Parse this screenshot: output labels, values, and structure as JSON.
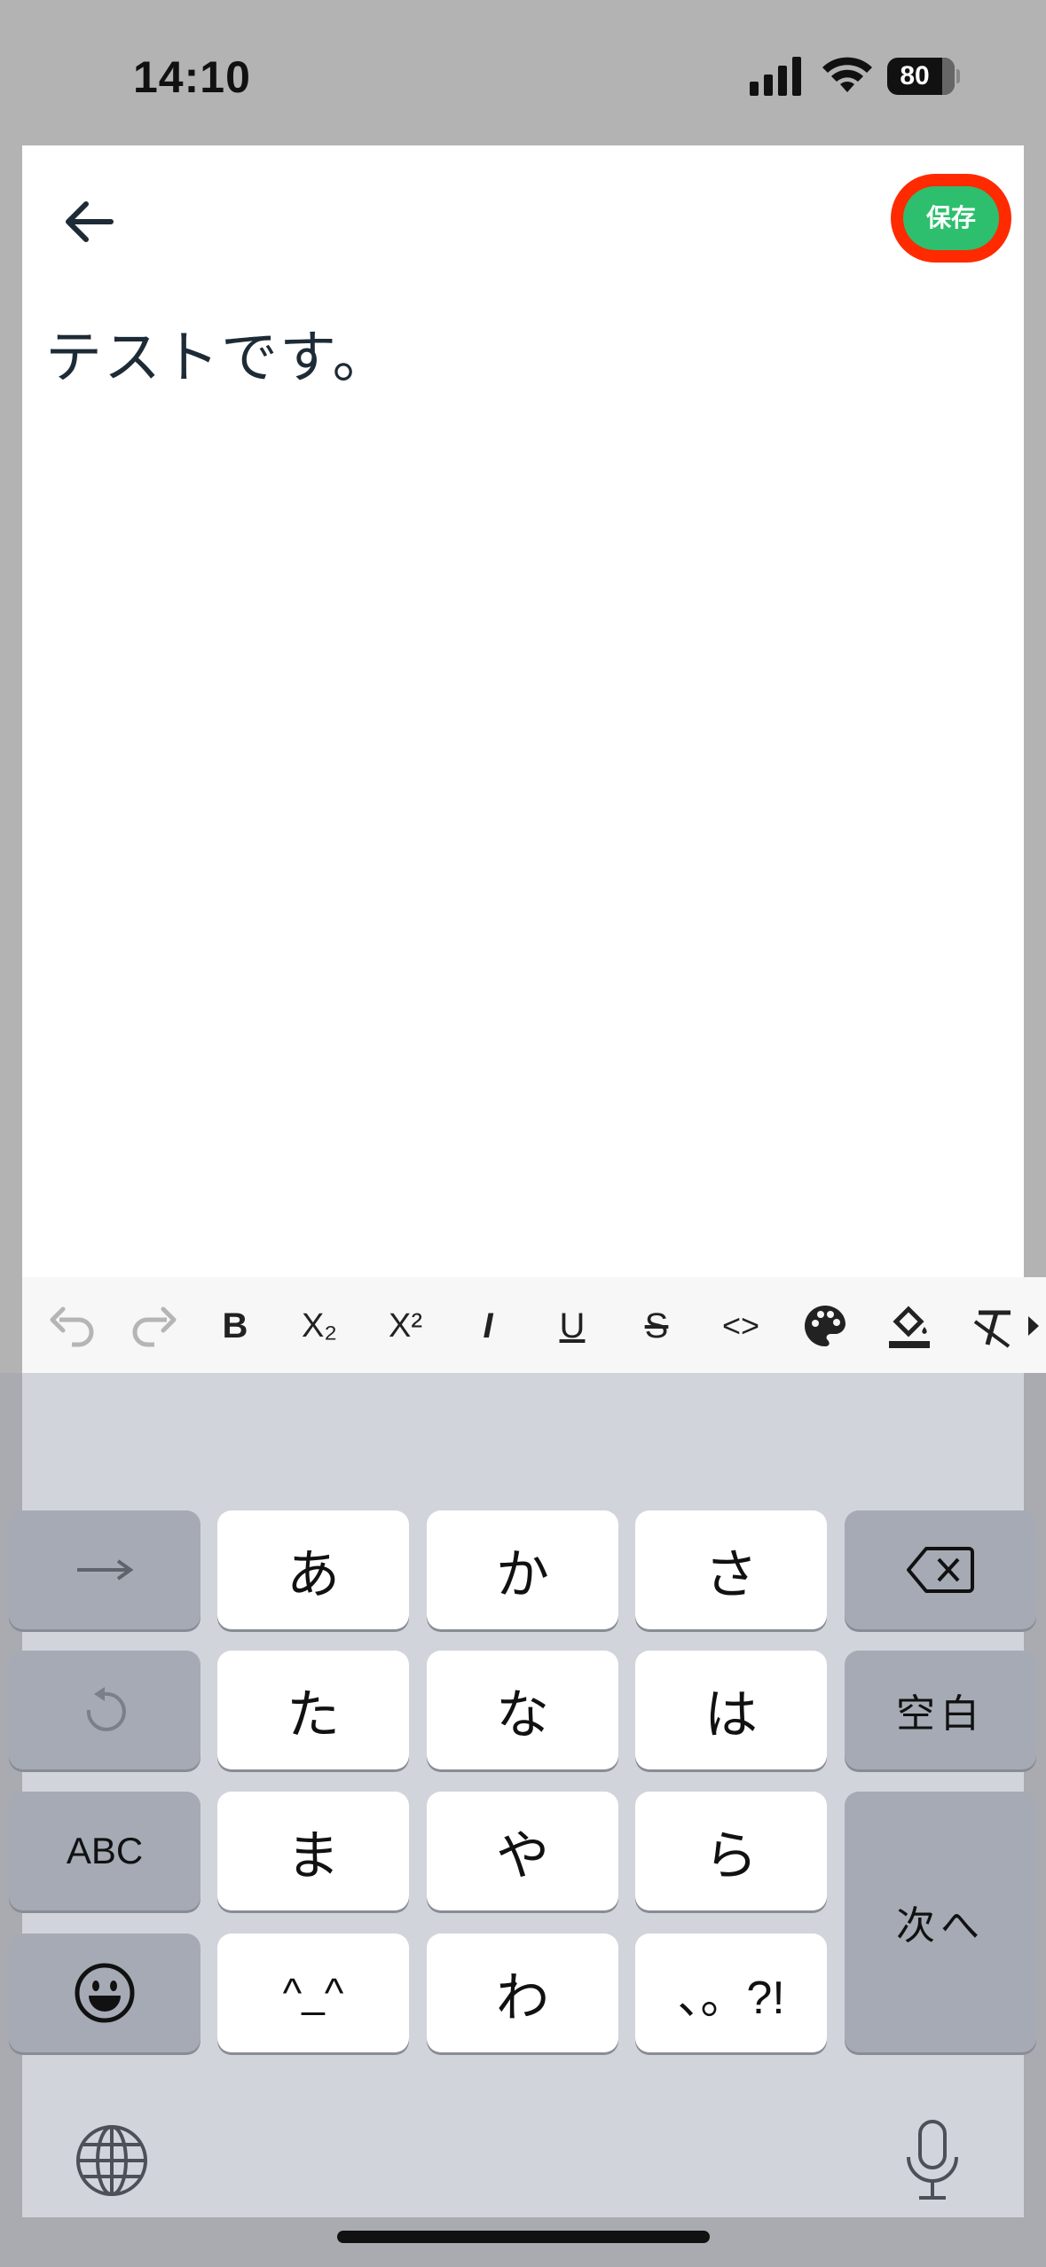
{
  "status_bar": {
    "time": "14:10",
    "battery": "80"
  },
  "header": {
    "save_label": "保存"
  },
  "editor": {
    "content": "テストです。"
  },
  "toolbar": {
    "bold": "B",
    "subscript": "X₂",
    "superscript": "X²",
    "italic": "I",
    "underline": "U",
    "strike": "S",
    "code": "<>"
  },
  "keyboard": {
    "row1": [
      "あ",
      "か",
      "さ"
    ],
    "row2": [
      "た",
      "な",
      "は"
    ],
    "row3": [
      "ま",
      "や",
      "ら"
    ],
    "row4": [
      "^_^",
      "わ",
      "、。?!"
    ],
    "abc": "ABC",
    "space": "空白",
    "next": "次へ"
  }
}
